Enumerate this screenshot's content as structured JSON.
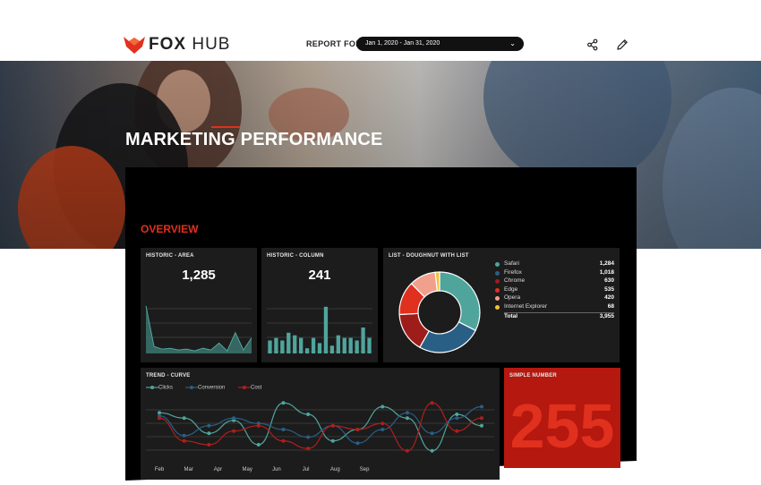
{
  "header": {
    "brand_bold": "FOX",
    "brand_light": "HUB",
    "report_for_label": "REPORT FOR",
    "date_range": "Jan 1, 2020 - Jan 31, 2020",
    "icons": [
      "share-icon",
      "pencil-icon",
      "chevron-down-icon"
    ]
  },
  "hero": {
    "title": "MARKETING PERFORMANCE"
  },
  "overview": {
    "label": "OVERVIEW"
  },
  "colors": {
    "accent": "#e0301e",
    "teal": "#4fa59c",
    "blue": "#2a5f85",
    "red": "#b01e1b",
    "panel": "#1c1c1c"
  },
  "cards": {
    "area": {
      "title": "HISTORIC - AREA",
      "value": "1,285"
    },
    "column": {
      "title": "HISTORIC - COLUMN",
      "value": "241"
    },
    "doughnut": {
      "title": "LIST - DOUGHNUT WITH LIST",
      "items": [
        {
          "label": "Safari",
          "value": "1,284",
          "color": "#4fa59c"
        },
        {
          "label": "Firefox",
          "value": "1,018",
          "color": "#2a5f85"
        },
        {
          "label": "Chrome",
          "value": "630",
          "color": "#9e1c1a"
        },
        {
          "label": "Edge",
          "value": "535",
          "color": "#e0301e"
        },
        {
          "label": "Opera",
          "value": "420",
          "color": "#f0a08c"
        },
        {
          "label": "Internet Explorer",
          "value": "68",
          "color": "#f2c230"
        }
      ],
      "total_label": "Total",
      "total_value": "3,955"
    },
    "trend": {
      "title": "TREND - CURVE",
      "series_names": [
        "Clicks",
        "Conversion",
        "Cost"
      ],
      "months": [
        "Feb",
        "Mar",
        "Apr",
        "May",
        "Jun",
        "Jul",
        "Aug",
        "Sep"
      ]
    },
    "simple": {
      "title": "SIMPLE NUMBER",
      "value": "255"
    }
  },
  "chart_data": [
    {
      "type": "area",
      "title": "HISTORIC - AREA",
      "values": [
        55,
        8,
        5,
        6,
        4,
        5,
        3,
        6,
        4,
        12,
        3,
        24,
        4,
        18
      ]
    },
    {
      "type": "bar",
      "title": "HISTORIC - COLUMN",
      "values": [
        5,
        6,
        5,
        8,
        7,
        6,
        2,
        6,
        4,
        18,
        3,
        7,
        6,
        6,
        5,
        10,
        6
      ]
    },
    {
      "type": "pie",
      "title": "LIST - DOUGHNUT WITH LIST",
      "categories": [
        "Safari",
        "Firefox",
        "Chrome",
        "Edge",
        "Opera",
        "Internet Explorer"
      ],
      "values": [
        1284,
        1018,
        630,
        535,
        420,
        68
      ]
    },
    {
      "type": "line",
      "title": "TREND - CURVE",
      "x": [
        "Feb",
        "Mar",
        "Apr",
        "May",
        "Jun",
        "Jul",
        "Aug",
        "Sep"
      ],
      "series": [
        {
          "name": "Clicks",
          "values": [
            62,
            55,
            35,
            52,
            20,
            75,
            60,
            25,
            40,
            70,
            55,
            12,
            60,
            45
          ]
        },
        {
          "name": "Conversion",
          "values": [
            58,
            32,
            45,
            55,
            48,
            40,
            30,
            45,
            22,
            40,
            62,
            35,
            55,
            70
          ]
        },
        {
          "name": "Cost",
          "values": [
            55,
            25,
            20,
            38,
            45,
            25,
            15,
            45,
            40,
            48,
            12,
            75,
            38,
            55
          ]
        }
      ]
    }
  ]
}
